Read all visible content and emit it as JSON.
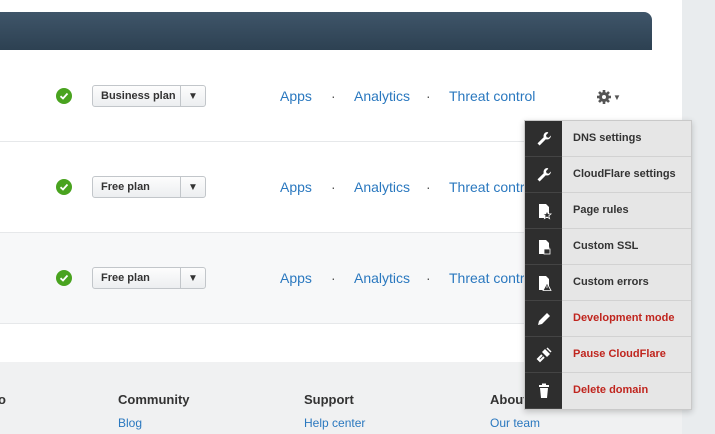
{
  "domains": [
    {
      "plan": "Business plan",
      "status": "active"
    },
    {
      "plan": "Free plan",
      "status": "active"
    },
    {
      "plan": "Free plan",
      "status": "active"
    }
  ],
  "links": {
    "apps": "Apps",
    "analytics": "Analytics",
    "threat": "Threat control",
    "separator": "·"
  },
  "menu": {
    "items": [
      {
        "label": "DNS settings",
        "icon": "wrench-icon",
        "danger": false
      },
      {
        "label": "CloudFlare settings",
        "icon": "wrench-icon",
        "danger": false
      },
      {
        "label": "Page rules",
        "icon": "page-star-icon",
        "danger": false
      },
      {
        "label": "Custom SSL",
        "icon": "page-lock-icon",
        "danger": false
      },
      {
        "label": "Custom errors",
        "icon": "page-warning-icon",
        "danger": false
      },
      {
        "label": "Development mode",
        "icon": "pencil-icon",
        "danger": true
      },
      {
        "label": "Pause CloudFlare",
        "icon": "unplug-icon",
        "danger": true
      },
      {
        "label": "Delete domain",
        "icon": "trash-icon",
        "danger": true
      }
    ]
  },
  "footer": {
    "col0": {
      "heading": "o"
    },
    "col1": {
      "heading": "Community",
      "link": "Blog"
    },
    "col2": {
      "heading": "Support",
      "link": "Help center"
    },
    "col3": {
      "heading": "About",
      "link": "Our team"
    }
  },
  "colors": {
    "accent": "#2a78bf",
    "success": "#49a31f",
    "danger": "#c0251e",
    "header": "#34495c"
  }
}
